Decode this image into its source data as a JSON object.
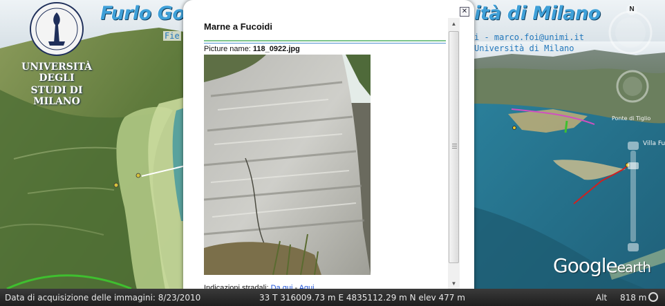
{
  "overlay": {
    "title_left": "Furlo Gorg",
    "title_right": "ità di Milano",
    "credit_left": "Fie",
    "credit_line1": "i - marco.foi@unimi.it",
    "credit_line2": "Università di Milano"
  },
  "logo": {
    "line1": "UNIVERSITÀ DEGLI",
    "line2": "STUDI DI MILANO"
  },
  "map_labels": {
    "place1": "Ponte di Tiglio",
    "place2": "Villa Fu"
  },
  "compass": {
    "north": "N"
  },
  "google_logo": {
    "google": "Google",
    "earth": "earth"
  },
  "balloon": {
    "title": "Marne a Fucoidi",
    "close": "✕",
    "picture_label": "Picture name: ",
    "picture_name": "118_0922.jpg",
    "directions_label": "Indicazioni stradali: ",
    "directions_from": "Da qui",
    "directions_sep": " - ",
    "directions_to": "Aqui"
  },
  "statusbar": {
    "imagery_date": "Data di acquisizione delle immagini: 8/23/2010",
    "coords": "33 T 316009.73 m E 4835112.29 m N elev   477 m",
    "alt_label": "Alt",
    "alt_value": "818 m"
  },
  "colors": {
    "accent_blue": "#3fa0d8",
    "link_blue": "#1a4fd6",
    "rule_green": "#7cc48a",
    "rule_blue": "#4f8fcf"
  }
}
